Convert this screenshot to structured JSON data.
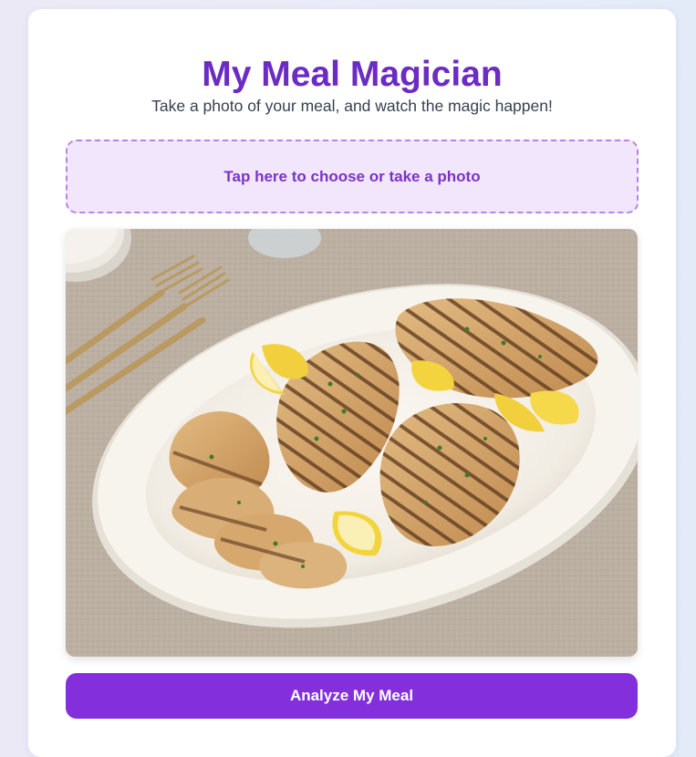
{
  "app": {
    "title": "My Meal Magician",
    "subtitle": "Take a photo of your meal, and watch the magic happen!"
  },
  "upload": {
    "label": "Tap here to choose or take a photo"
  },
  "photo": {
    "subject": "grilled-chicken-platter"
  },
  "actions": {
    "analyze_label": "Analyze My Meal"
  },
  "colors": {
    "accent": "#8330dc",
    "title": "#6b2bc4",
    "upload_bg": "#f2e6fc",
    "upload_border": "#b784e6"
  }
}
